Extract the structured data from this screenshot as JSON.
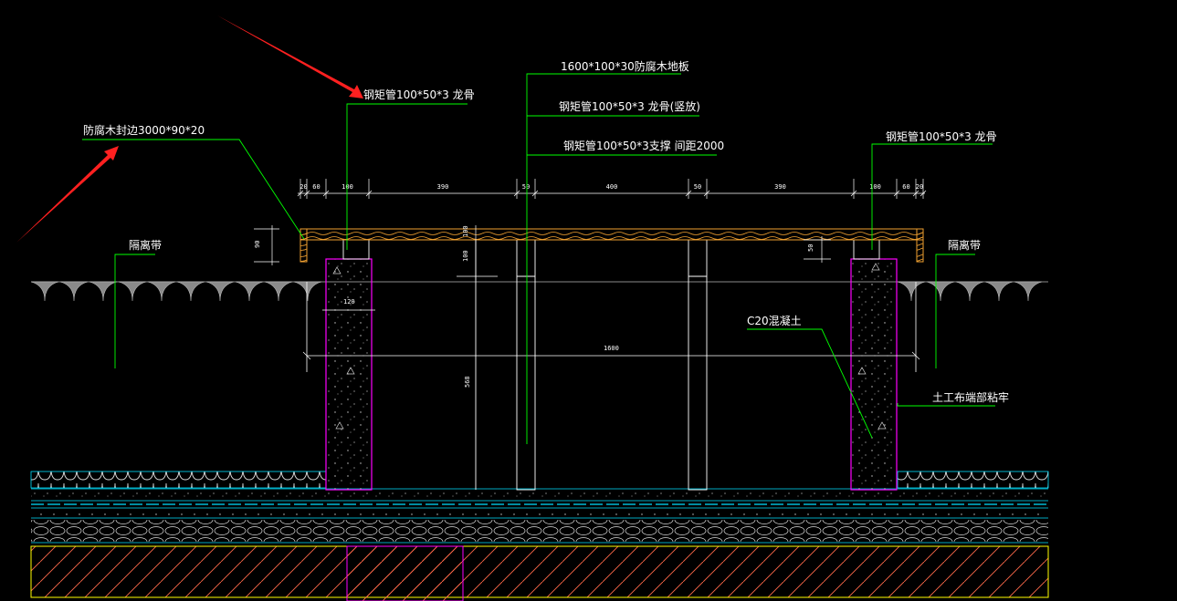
{
  "colors": {
    "background": "#000000",
    "leader": "#00ff00",
    "dimension": "#ffffff",
    "column": "#ff00ff",
    "wood": "#f0a030",
    "arrow": "#ff2020",
    "hatch": "#ffffff",
    "ground": "#888888",
    "layer_cyan": "#00e0ff",
    "slab_border": "#ffff00",
    "slab_hatch": "#ff6a4a"
  },
  "labels": {
    "deck": "1600*100*30防腐木地板",
    "keel_left": "钢矩管100*50*3  龙骨",
    "keel_vertical": "钢矩管100*50*3  龙骨(竖放)",
    "brace": "钢矩管100*50*3支撑  间距2000",
    "keel_right": "钢矩管100*50*3  龙骨",
    "edge_wood": "防腐木封边3000*90*20",
    "isolation_left": "隔离带",
    "isolation_right": "隔离带",
    "concrete": "C20混凝土",
    "geotextile": "土工布端部粘牢"
  },
  "dimensions": {
    "top_chain": [
      "20",
      "60",
      "100",
      "390",
      "50",
      "400",
      "50",
      "390",
      "100",
      "60",
      "20"
    ],
    "edge_height": "90",
    "deck_height": "100",
    "keel_height": "100",
    "drop_right": "50",
    "column_width": "120",
    "overall_width": "1600",
    "column_depth": "568"
  },
  "icons": {
    "arrow_top": "red-arrow-icon",
    "arrow_left": "red-arrow-icon"
  }
}
